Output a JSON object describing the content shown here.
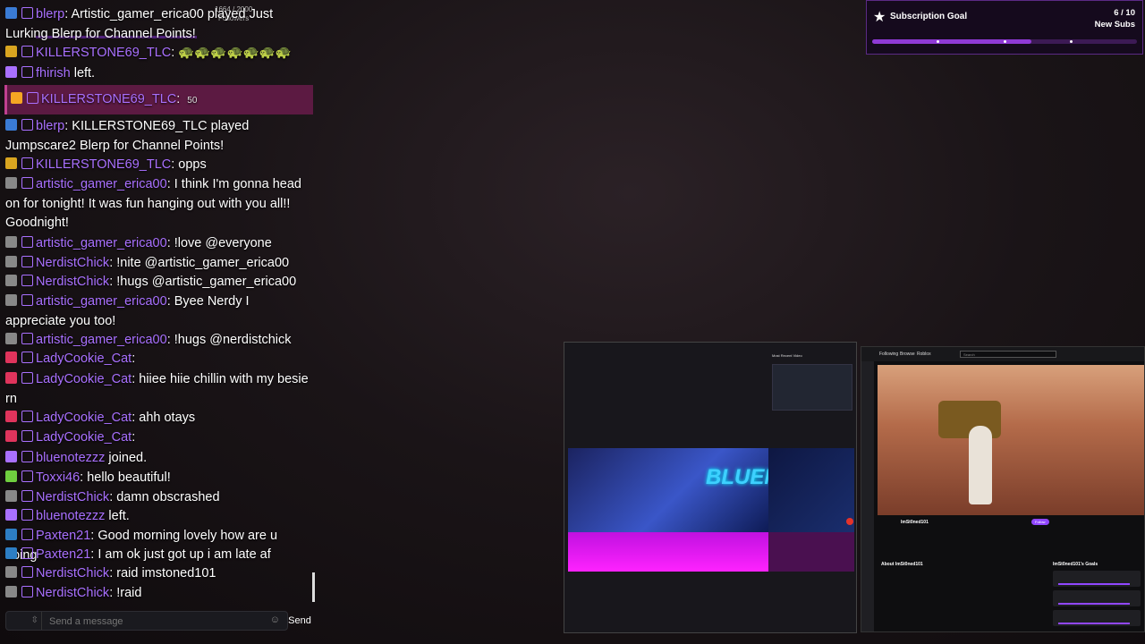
{
  "chat": {
    "messages": [
      {
        "name": "blerp",
        "text": ": Artistic_gamer_erica00 played Just Lurking Blerp for Channel Points!"
      },
      {
        "name": "KILLERSTONE69_TLC",
        "text": ": 🐢🐢🐢🐢🐢🐢🐢"
      },
      {
        "name": "fhirish",
        "text": " left."
      },
      {
        "name": "blerp",
        "text": ": KILLERSTONE69_TLC played Jumpscare2 Blerp for Channel Points!"
      },
      {
        "name": "KILLERSTONE69_TLC",
        "text": ": opps"
      },
      {
        "name": "artistic_gamer_erica00",
        "text": ": I think I'm gonna head on for tonight! It was fun hanging out with you all!! Goodnight!"
      },
      {
        "name": "artistic_gamer_erica00",
        "text": ": !love @everyone"
      },
      {
        "name": "NerdistChick",
        "text": ": !nite @artistic_gamer_erica00"
      },
      {
        "name": "NerdistChick",
        "text": ": !hugs @artistic_gamer_erica00"
      },
      {
        "name": "artistic_gamer_erica00",
        "text": ": Byee Nerdy I appreciate you too!"
      },
      {
        "name": "artistic_gamer_erica00",
        "text": ": !hugs @nerdistchick"
      },
      {
        "name": "LadyCookie_Cat",
        "text": ":"
      },
      {
        "name": "LadyCookie_Cat",
        "text": ": hiiee hiie chillin with my besie rn"
      },
      {
        "name": "LadyCookie_Cat",
        "text": ": ahh otays"
      },
      {
        "name": "LadyCookie_Cat",
        "text": ":"
      },
      {
        "name": "bluenotezzz",
        "text": " joined."
      },
      {
        "name": "Toxxi46",
        "text": ": hello beautiful!"
      },
      {
        "name": "NerdistChick",
        "text": ": damn obscrashed"
      },
      {
        "name": "bluenotezzz",
        "text": " left."
      },
      {
        "name": "Paxten21",
        "text": ": Good morning lovely how are u doing"
      },
      {
        "name": "Paxten21",
        "text": ": I am ok just got up i am late af"
      },
      {
        "name": "NerdistChick",
        "text": ": raid imstoned101"
      },
      {
        "name": "NerdistChick",
        "text": ": !raid"
      }
    ],
    "highlight": {
      "name": "KILLERSTONE69_TLC",
      "text": ":",
      "bits": "50"
    },
    "followers_label": "Followers",
    "followers_count": "1664 / 2000",
    "input_placeholder": "Send a message",
    "send_label": "Send"
  },
  "sub_goal": {
    "title": "Subscription Goal",
    "count": "6 / 10",
    "unit": "New Subs",
    "progress": 0.6
  },
  "panel_left": {
    "recent_label": "Most Recent Video",
    "banner_text": "BLUENOTEZ"
  },
  "panel_right": {
    "nav": [
      "Following",
      "Browse",
      "Roblox"
    ],
    "search_placeholder": "Search",
    "streamer": "ImSt0ned101",
    "follow_label": "Follow",
    "about_label": "About ImSt0ned101",
    "goals_label": "ImSt0ned101's Goals"
  },
  "colors": {
    "accent": "#a970ff",
    "goal": "#8f3ad6",
    "highlight": "#5c1a42"
  }
}
